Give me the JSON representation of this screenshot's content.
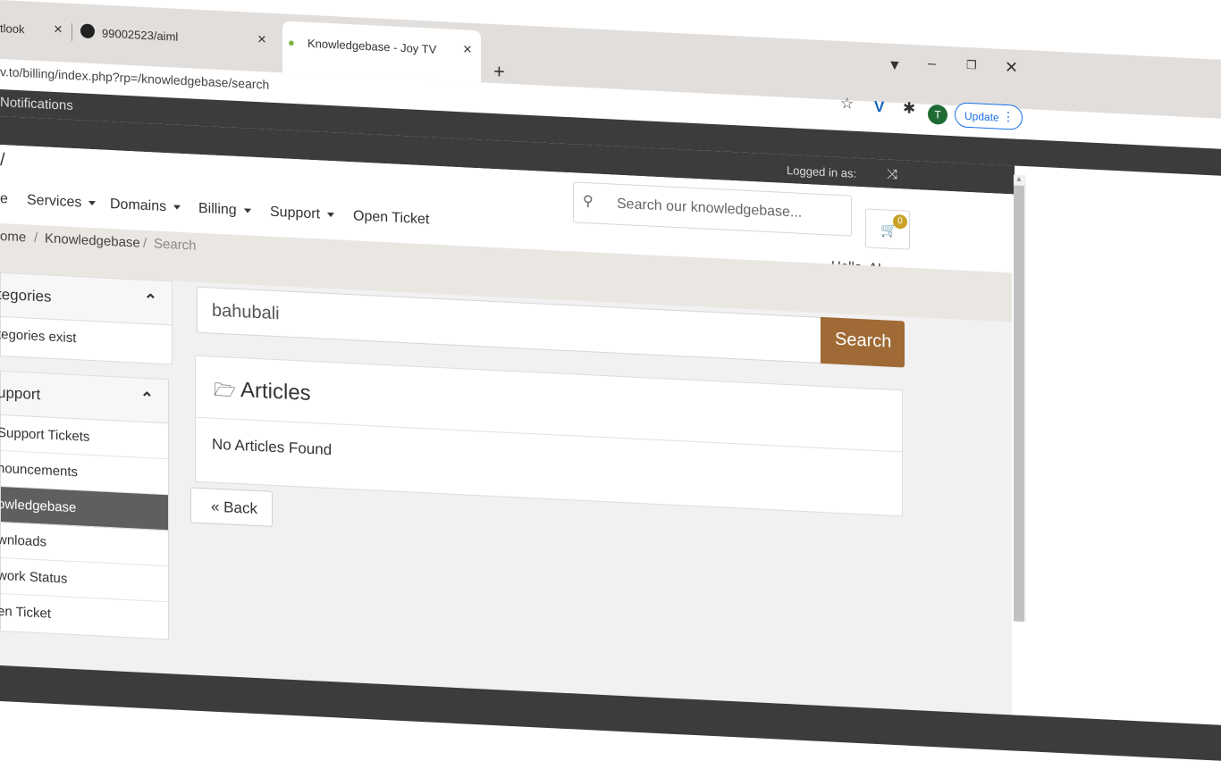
{
  "browser": {
    "tabs": [
      {
        "title": "tlook"
      },
      {
        "title": "99002523/aiml"
      },
      {
        "title": "Knowledgebase - Joy TV"
      }
    ],
    "close_glyph": "×",
    "new_tab_glyph": "+",
    "url": "v.to/billing/index.php?rp=/knowledgebase/search",
    "profile_initial": "T",
    "update_label": "Update"
  },
  "notifications_label": "Notifications",
  "topbar": {
    "logged_in": "Logged in as:"
  },
  "logo_text": "/",
  "nav": {
    "items": [
      {
        "label": "e"
      },
      {
        "label": "Services"
      },
      {
        "label": "Domains"
      },
      {
        "label": "Billing"
      },
      {
        "label": "Support"
      },
      {
        "label": "Open Ticket"
      }
    ]
  },
  "kb_search": {
    "placeholder": "Search our knowledgebase..."
  },
  "cart": {
    "count": "0"
  },
  "user": {
    "greeting": "Hello, A!"
  },
  "breadcrumb": [
    {
      "label": "ome"
    },
    {
      "label": "Knowledgebase"
    },
    {
      "label": "Search"
    }
  ],
  "breadcrumb_sep": "/",
  "sidebar": {
    "categories": {
      "title": "tegories",
      "rows": [
        "tegories exist"
      ]
    },
    "support": {
      "title": "upport",
      "rows": [
        "Support Tickets",
        "nouncements",
        "owledgebase",
        "wnloads",
        "work Status",
        "en Ticket"
      ],
      "active_index": 2
    }
  },
  "search": {
    "value": "bahubali",
    "button": "Search"
  },
  "articles": {
    "title": "Articles",
    "empty": "No Articles Found"
  },
  "back_button": "« Back",
  "colors": {
    "accent": "#9f6a35",
    "topbar": "#3c3c3c",
    "badge": "#c9a227"
  }
}
